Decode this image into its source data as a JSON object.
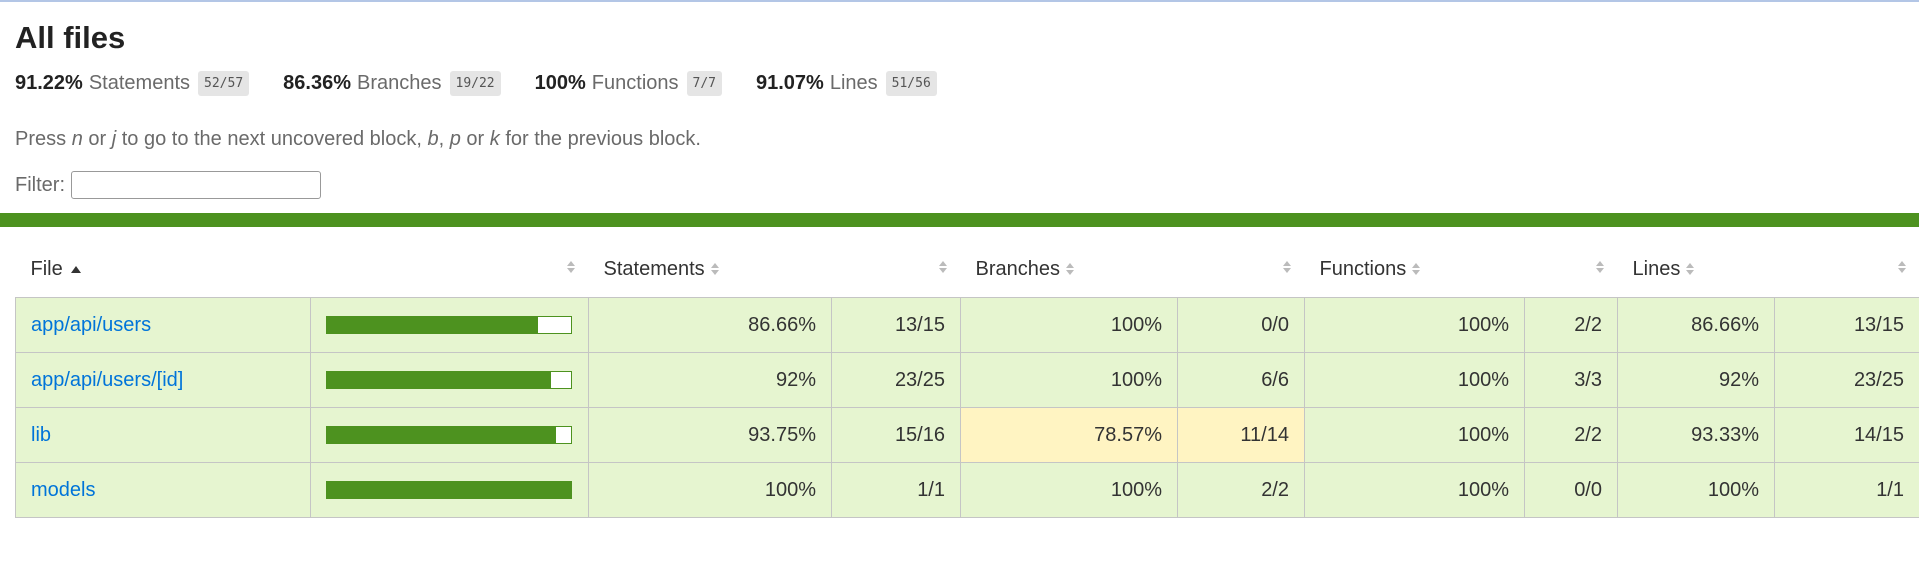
{
  "page": {
    "title": "All files",
    "hint_parts": [
      "Press ",
      "n",
      " or ",
      "j",
      " to go to the next uncovered block, ",
      "b",
      ", ",
      "p",
      " or ",
      "k",
      " for the previous block."
    ],
    "filter_label": "Filter:",
    "filter_value": ""
  },
  "summary": [
    {
      "pct": "91.22%",
      "label": "Statements",
      "fraction": "52/57"
    },
    {
      "pct": "86.36%",
      "label": "Branches",
      "fraction": "19/22"
    },
    {
      "pct": "100%",
      "label": "Functions",
      "fraction": "7/7"
    },
    {
      "pct": "91.07%",
      "label": "Lines",
      "fraction": "51/56"
    }
  ],
  "colors": {
    "high": "#e6f5d0",
    "medium": "#fff4c2",
    "bar": "#4d921f",
    "link": "#0074d9"
  },
  "table": {
    "headers": {
      "file": "File",
      "statements": "Statements",
      "branches": "Branches",
      "functions": "Functions",
      "lines": "Lines"
    },
    "rows": [
      {
        "file": "app/api/users",
        "coverage": 0.8666,
        "statements_pct": "86.66%",
        "statements_frac": "13/15",
        "branches_pct": "100%",
        "branches_frac": "0/0",
        "functions_pct": "100%",
        "functions_frac": "2/2",
        "lines_pct": "86.66%",
        "lines_frac": "13/15",
        "branches_level": "high"
      },
      {
        "file": "app/api/users/[id]",
        "coverage": 0.92,
        "statements_pct": "92%",
        "statements_frac": "23/25",
        "branches_pct": "100%",
        "branches_frac": "6/6",
        "functions_pct": "100%",
        "functions_frac": "3/3",
        "lines_pct": "92%",
        "lines_frac": "23/25",
        "branches_level": "high"
      },
      {
        "file": "lib",
        "coverage": 0.9375,
        "statements_pct": "93.75%",
        "statements_frac": "15/16",
        "branches_pct": "78.57%",
        "branches_frac": "11/14",
        "functions_pct": "100%",
        "functions_frac": "2/2",
        "lines_pct": "93.33%",
        "lines_frac": "14/15",
        "branches_level": "medium"
      },
      {
        "file": "models",
        "coverage": 1.0,
        "statements_pct": "100%",
        "statements_frac": "1/1",
        "branches_pct": "100%",
        "branches_frac": "2/2",
        "functions_pct": "100%",
        "functions_frac": "0/0",
        "lines_pct": "100%",
        "lines_frac": "1/1",
        "branches_level": "high"
      }
    ]
  }
}
